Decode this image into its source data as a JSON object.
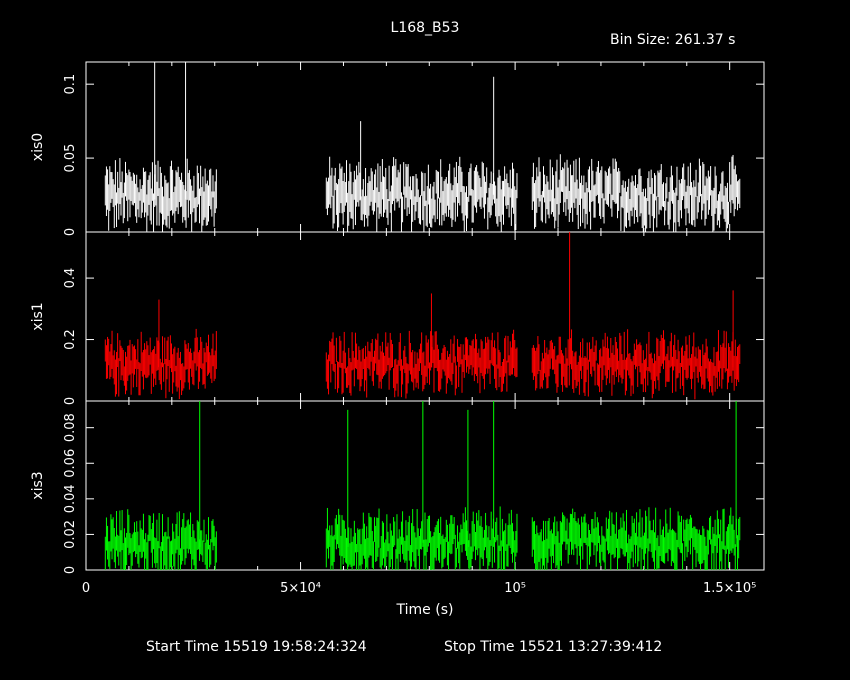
{
  "title": "L168_B53",
  "bin_size": "Bin Size: 261.37 s",
  "footer": {
    "start_time": "Start Time 15519 19:58:24:324",
    "stop_time": "Stop Time 15521 13:27:39:412"
  },
  "colors": {
    "xis0": "#ffffff",
    "xis1": "#ff0000",
    "xis3": "#00ff00"
  },
  "chart_data": {
    "type": "scatter",
    "xlabel": "Time (s)",
    "xlim": [
      0,
      158000
    ],
    "x_ticks": [
      {
        "v": 0,
        "label": "0"
      },
      {
        "v": 50000,
        "label": "5×10⁴"
      },
      {
        "v": 100000,
        "label": "10⁵"
      },
      {
        "v": 150000,
        "label": "1.5×10⁵"
      }
    ],
    "gti": [
      [
        4500,
        30500
      ],
      [
        56000,
        100500
      ],
      [
        104000,
        152500
      ]
    ],
    "bin": 261.37,
    "panels": [
      {
        "name": "xis0",
        "ylabel": "xis0",
        "ylim": [
          0,
          0.115
        ],
        "yticks": [
          {
            "v": 0,
            "label": "0"
          },
          {
            "v": 0.05,
            "label": "0.05"
          },
          {
            "v": 0.1,
            "label": "0.1"
          }
        ],
        "mean": 0.022,
        "noise": 0.012,
        "spikes": [
          {
            "t": 16000,
            "v": 0.115
          },
          {
            "t": 23200,
            "v": 0.115
          },
          {
            "t": 95000,
            "v": 0.105
          },
          {
            "t": 64000,
            "v": 0.075
          }
        ]
      },
      {
        "name": "xis1",
        "ylabel": "xis1",
        "ylim": [
          0,
          0.55
        ],
        "yticks": [
          {
            "v": 0,
            "label": "0"
          },
          {
            "v": 0.2,
            "label": "0.2"
          },
          {
            "v": 0.4,
            "label": "0.4"
          }
        ],
        "mean": 0.11,
        "noise": 0.05,
        "spikes": [
          {
            "t": 112700,
            "v": 0.55
          },
          {
            "t": 150800,
            "v": 0.36
          },
          {
            "t": 80500,
            "v": 0.35
          },
          {
            "t": 17000,
            "v": 0.33
          }
        ]
      },
      {
        "name": "xis3",
        "ylabel": "xis3",
        "ylim": [
          0,
          0.095
        ],
        "yticks": [
          {
            "v": 0,
            "label": "0"
          },
          {
            "v": 0.02,
            "label": "0.02"
          },
          {
            "v": 0.04,
            "label": "0.04"
          },
          {
            "v": 0.06,
            "label": "0.06"
          },
          {
            "v": 0.08,
            "label": "0.08"
          }
        ],
        "mean": 0.013,
        "noise": 0.009,
        "spikes": [
          {
            "t": 26500,
            "v": 0.095
          },
          {
            "t": 61000,
            "v": 0.09
          },
          {
            "t": 78500,
            "v": 0.095
          },
          {
            "t": 89000,
            "v": 0.09
          },
          {
            "t": 95000,
            "v": 0.095
          },
          {
            "t": 151500,
            "v": 0.095
          }
        ]
      }
    ]
  }
}
